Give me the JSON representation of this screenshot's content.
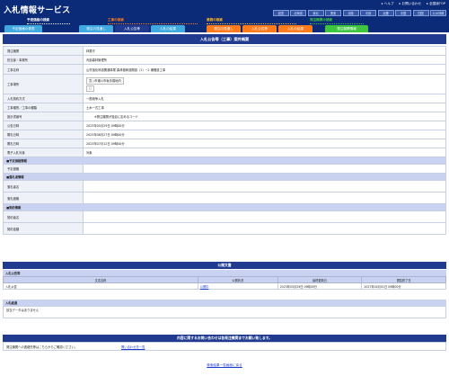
{
  "header": {
    "logo": "入札情報サービス",
    "links": [
      "ヘルプ",
      "お問い合わせ",
      "全国版TOP"
    ],
    "regions": [
      "全国",
      "北海道",
      "東北",
      "関東",
      "北陸",
      "中部",
      "近畿",
      "中国",
      "四国",
      "九州沖縄"
    ],
    "categories": [
      {
        "label": "予定価格の検索",
        "color": "#ffffff"
      },
      {
        "label": "工事の検索",
        "color": "#ff7b1c"
      },
      {
        "label": "業務の検索",
        "color": "#ffb820"
      },
      {
        "label": "発注機関の検索",
        "color": "#3fc63f"
      }
    ],
    "tabs": [
      {
        "label": "予定価格の発表",
        "color": "#3fa9e0"
      },
      {
        "label": "発注の見通し",
        "color": "#3fa9e0"
      },
      {
        "label": "入札公告等",
        "color": "#1f3a8f"
      },
      {
        "label": "入札の結果",
        "color": "#3fa9e0"
      },
      {
        "label": "発注の見通し",
        "color": "#ff7b1c"
      },
      {
        "label": "入札公告等",
        "color": "#ff7b1c"
      },
      {
        "label": "入札の結果",
        "color": "#ff7b1c"
      },
      {
        "label": "発注機関情報",
        "color": "#3fc63f"
      }
    ]
  },
  "main": {
    "title": "入札公告等（工事）案件概要",
    "rows": [
      {
        "key": "発注機関",
        "value": "林業庁"
      },
      {
        "key": "担当部・事務所",
        "value": "青部森林管理所"
      },
      {
        "key": "工事名称",
        "value": "山村強化林道開通事業 森林基幹道開設（1）−2 補聞設工事"
      },
      {
        "key": "工事場所",
        "value": "富○市潮川市坂手橋地内",
        "extra": "□"
      },
      {
        "key": "入札契約方式",
        "value": "一般競争入札"
      },
      {
        "key": "工事種別／工事の種類",
        "value": "土木一式工事"
      },
      {
        "key": "設計書番号",
        "value": "※発注機関が独自に定めるコード"
      },
      {
        "key": "公告日時",
        "value": "2023年05月29日 09時00分"
      },
      {
        "key": "開札日時",
        "value": "2023年06月27日 09時00分"
      },
      {
        "key": "開札日時",
        "value": "2023年07月12日 09時00分"
      },
      {
        "key": "電子入札対象",
        "value": "対象"
      }
    ],
    "sections": [
      {
        "title": "■予定価格情報",
        "rows": [
          {
            "key": "予定価格",
            "value": ""
          }
        ]
      },
      {
        "title": "■落札者情報",
        "rows": [
          {
            "key": "落札者名",
            "value": ""
          },
          {
            "key": "落札価格",
            "value": ""
          }
        ]
      },
      {
        "title": "■契約情報",
        "rows": [
          {
            "key": "契約者名",
            "value": ""
          },
          {
            "key": "契約金額",
            "value": ""
          }
        ]
      }
    ]
  },
  "docs": {
    "title": "公開文書",
    "head": "入札公告等",
    "columns": [
      "文書名称",
      "公開状況",
      "最終更新日",
      "閲覧終了日"
    ],
    "row": {
      "name": "入札公告",
      "status": "公開中",
      "updated": "2023年05月29日 09時00分",
      "end": "2027年04月01日 09時00分"
    }
  },
  "result": {
    "head": "入札経過",
    "empty": "該当データはありません"
  },
  "contact": {
    "title": "内容に関するお問い合わせは各発注機関までお願い致します。",
    "text": "発注機関への連絡先等はこちらからご確認ください。",
    "link": "問い合わせ先一覧"
  },
  "back_link": "検索結果一覧画面に戻る"
}
